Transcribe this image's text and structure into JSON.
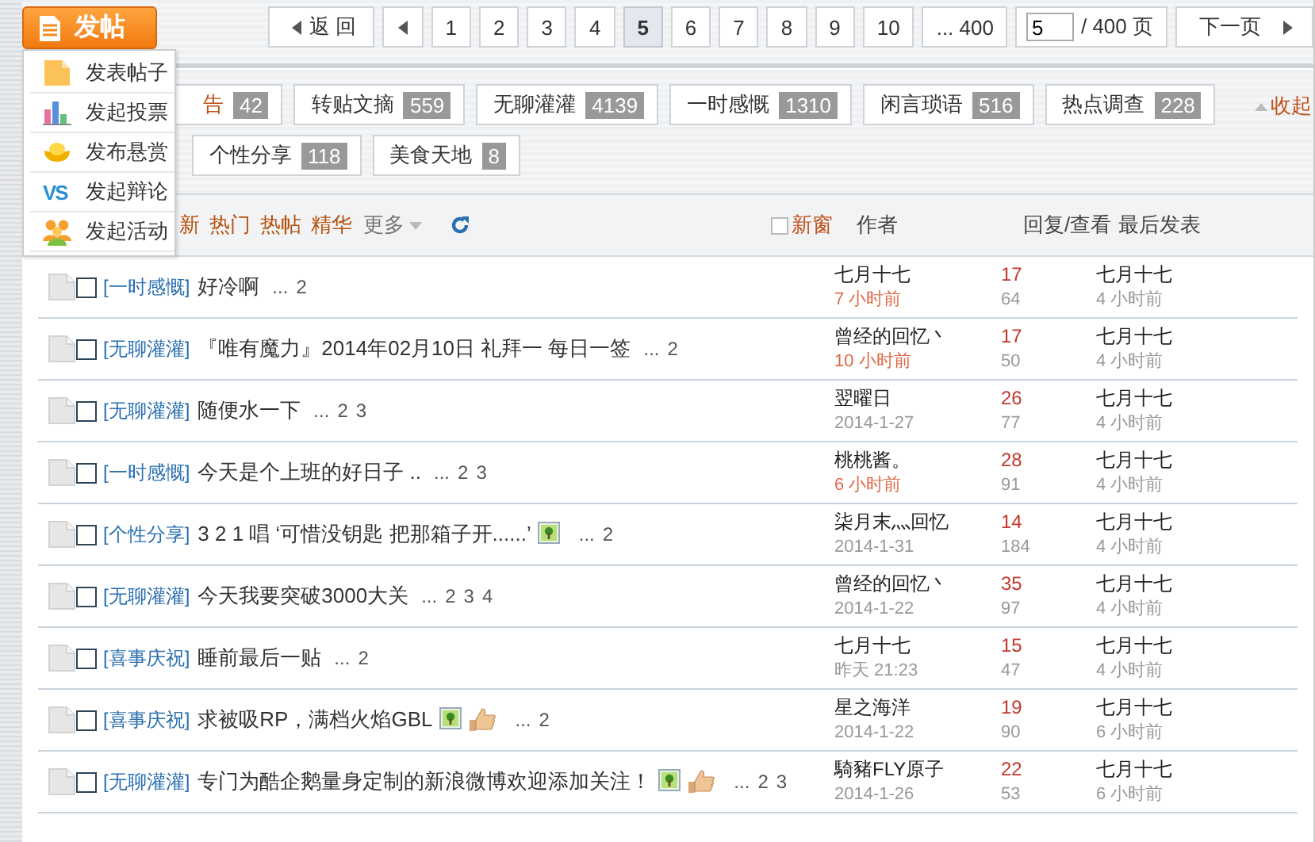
{
  "post_button": {
    "label": "发帖"
  },
  "post_menu": {
    "items": [
      {
        "kind": "doc",
        "label": "发表帖子"
      },
      {
        "kind": "chart",
        "label": "发起投票"
      },
      {
        "kind": "ingot",
        "label": "发布悬赏"
      },
      {
        "kind": "vs",
        "icon_text": "VS",
        "label": "发起辩论"
      },
      {
        "kind": "people",
        "label": "发起活动"
      }
    ]
  },
  "pager": {
    "back": "返 回",
    "pages": [
      {
        "label": "1",
        "selected": false
      },
      {
        "label": "2",
        "selected": false
      },
      {
        "label": "3",
        "selected": false
      },
      {
        "label": "4",
        "selected": false
      },
      {
        "label": "5",
        "selected": true
      },
      {
        "label": "6",
        "selected": false
      },
      {
        "label": "7",
        "selected": false
      },
      {
        "label": "8",
        "selected": false
      },
      {
        "label": "9",
        "selected": false
      },
      {
        "label": "10",
        "selected": false
      },
      {
        "label": "... 400",
        "selected": false
      }
    ],
    "jump_value": "5",
    "jump_total": "/ 400 页",
    "next": "下一页"
  },
  "board_tags": {
    "rows": [
      [
        {
          "label": "告",
          "count": "42"
        },
        {
          "label": "转贴文摘",
          "count": "559"
        },
        {
          "label": "无聊灌灌",
          "count": "4139"
        },
        {
          "label": "一时感慨",
          "count": "1310"
        },
        {
          "label": "闲言琐语",
          "count": "516"
        },
        {
          "label": "热点调查",
          "count": "228"
        }
      ],
      [
        {
          "label": "个性分享",
          "count": "118"
        },
        {
          "label": "美食天地",
          "count": "8"
        }
      ]
    ],
    "collapse": "收起"
  },
  "filters": {
    "tabs": [
      {
        "label": "新"
      },
      {
        "label": "热门"
      },
      {
        "label": "热帖"
      },
      {
        "label": "精华"
      }
    ],
    "more": "更多"
  },
  "columns": {
    "new_window": {
      "label": "新窗",
      "checked": false
    },
    "author": "作者",
    "replies": "回复/查看",
    "last_post": "最后发表"
  },
  "threads": [
    {
      "category": "[一时感慨]",
      "title": "好冷啊",
      "ellipsis": "...",
      "pages": [
        "2"
      ],
      "selected": false,
      "author": "七月十七",
      "posted": "7 小时前",
      "recent": true,
      "replies": "17",
      "views": "64",
      "last_author": "七月十七",
      "last_time": "4 小时前"
    },
    {
      "category": "[无聊灌灌]",
      "title": "『唯有魔力』2014年02月10日 礼拜一 每日一签",
      "ellipsis": "...",
      "pages": [
        "2"
      ],
      "selected": false,
      "author": "曾经的回忆丶",
      "posted": "10 小时前",
      "recent": true,
      "replies": "17",
      "views": "50",
      "last_author": "七月十七",
      "last_time": "4 小时前"
    },
    {
      "category": "[无聊灌灌]",
      "title": "随便水一下",
      "ellipsis": "...",
      "pages": [
        "2",
        "3"
      ],
      "selected": false,
      "author": "翌曜日",
      "posted": "2014-1-27",
      "recent": false,
      "replies": "26",
      "views": "77",
      "last_author": "七月十七",
      "last_time": "4 小时前"
    },
    {
      "category": "[一时感慨]",
      "title": "今天是个上班的好日子 ..",
      "ellipsis": "...",
      "pages": [
        "2",
        "3"
      ],
      "selected": false,
      "author": "桃桃酱。",
      "posted": "6 小时前",
      "recent": true,
      "replies": "28",
      "views": "91",
      "last_author": "七月十七",
      "last_time": "4 小时前"
    },
    {
      "category": "[个性分享]",
      "title": "3 2 1 唱 ‘可惜没钥匙 把那箱子开......’",
      "attachments": [
        {
          "kind": "image"
        }
      ],
      "ellipsis": "...",
      "pages": [
        "2"
      ],
      "selected": false,
      "author": "柒月末灬回忆",
      "posted": "2014-1-31",
      "recent": false,
      "replies": "14",
      "views": "184",
      "last_author": "七月十七",
      "last_time": "4 小时前"
    },
    {
      "category": "[无聊灌灌]",
      "title": "今天我要突破3000大关",
      "ellipsis": "...",
      "pages": [
        "2",
        "3",
        "4"
      ],
      "selected": false,
      "author": "曾经的回忆丶",
      "posted": "2014-1-22",
      "recent": false,
      "replies": "35",
      "views": "97",
      "last_author": "七月十七",
      "last_time": "4 小时前"
    },
    {
      "category": "[喜事庆祝]",
      "title": "睡前最后一贴",
      "ellipsis": "...",
      "pages": [
        "2"
      ],
      "selected": false,
      "author": "七月十七",
      "posted": "昨天 21:23",
      "recent": false,
      "replies": "15",
      "views": "47",
      "last_author": "七月十七",
      "last_time": "4 小时前"
    },
    {
      "category": "[喜事庆祝]",
      "title": "求被吸RP，满档火焰GBL",
      "attachments": [
        {
          "kind": "image"
        },
        {
          "kind": "thumb"
        }
      ],
      "ellipsis": "...",
      "pages": [
        "2"
      ],
      "selected": false,
      "author": "星之海洋",
      "posted": "2014-1-22",
      "recent": false,
      "replies": "19",
      "views": "90",
      "last_author": "七月十七",
      "last_time": "6 小时前"
    },
    {
      "category": "[无聊灌灌]",
      "title": "专门为酷企鹅量身定制的新浪微博欢迎添加关注！",
      "attachments": [
        {
          "kind": "image"
        },
        {
          "kind": "thumb"
        }
      ],
      "ellipsis": "...",
      "pages": [
        "2",
        "3"
      ],
      "selected": false,
      "author": "騎豬FLY原子",
      "posted": "2014-1-26",
      "recent": false,
      "replies": "22",
      "views": "53",
      "last_author": "七月十七",
      "last_time": "6 小时前"
    }
  ]
}
